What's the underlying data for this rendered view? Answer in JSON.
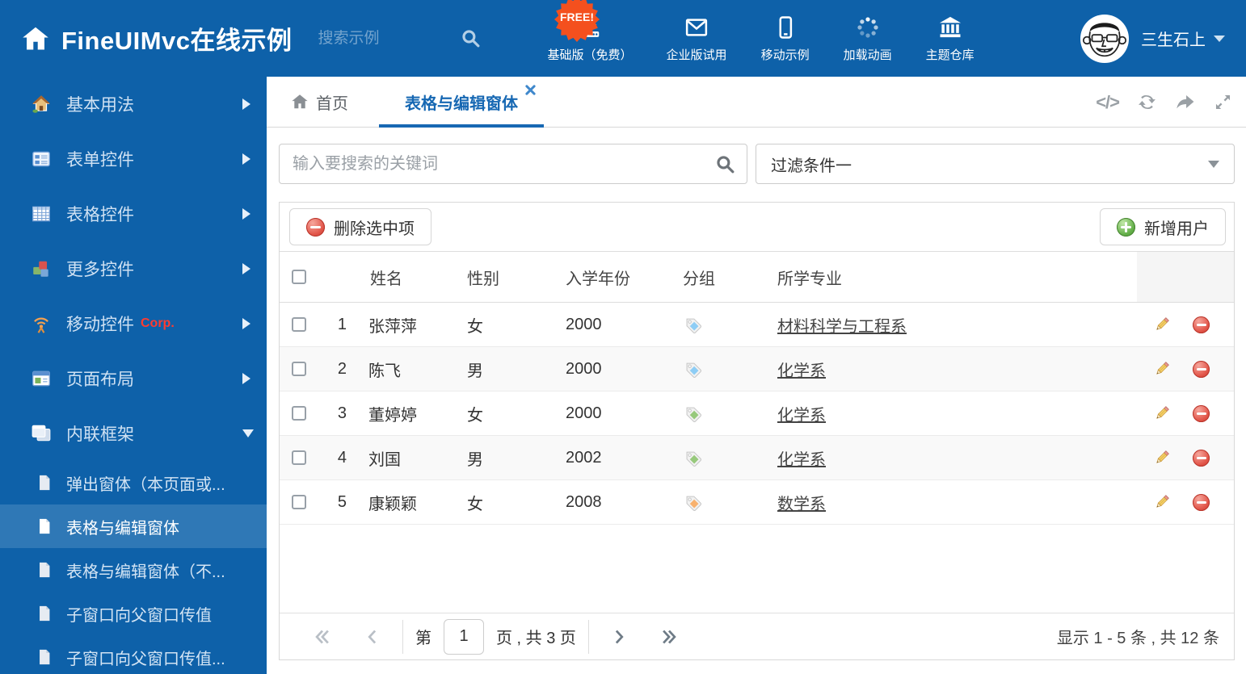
{
  "header": {
    "logo_text": "FineUIMvc在线示例",
    "search_placeholder": "搜索示例",
    "free_badge": "FREE!",
    "free_badge_color": "#f4501e",
    "nav_items": [
      {
        "label": "基础版（免费）",
        "icon": "download-icon"
      },
      {
        "label": "企业版试用",
        "icon": "envelope-icon"
      },
      {
        "label": "移动示例",
        "icon": "mobile-icon"
      },
      {
        "label": "加载动画",
        "icon": "spinner-icon"
      },
      {
        "label": "主题仓库",
        "icon": "bank-icon"
      }
    ],
    "user": {
      "name": "三生石上"
    }
  },
  "sidebar": {
    "items": [
      {
        "label": "基本用法",
        "icon": "house-icon"
      },
      {
        "label": "表单控件",
        "icon": "form-icon"
      },
      {
        "label": "表格控件",
        "icon": "grid-icon"
      },
      {
        "label": "更多控件",
        "icon": "cubes-icon"
      },
      {
        "label": "移动控件",
        "badge": "Corp.",
        "icon": "antenna-icon"
      },
      {
        "label": "页面布局",
        "icon": "layout-icon"
      },
      {
        "label": "内联框架",
        "icon": "frames-icon",
        "expanded": true
      }
    ],
    "subitems": [
      {
        "label": "弹出窗体（本页面或..."
      },
      {
        "label": "表格与编辑窗体",
        "active": true
      },
      {
        "label": "表格与编辑窗体（不..."
      },
      {
        "label": "子窗口向父窗口传值"
      },
      {
        "label": "子窗口向父窗口传值..."
      }
    ]
  },
  "tabs": {
    "home": {
      "label": "首页",
      "icon": "home-icon"
    },
    "active": {
      "label": "表格与编辑窗体",
      "closable": true
    }
  },
  "tab_tools": [
    "code-icon",
    "refresh-icon",
    "share-icon",
    "expand-icon"
  ],
  "filters": {
    "search_placeholder": "输入要搜索的关键词",
    "filter_value": "过滤条件一"
  },
  "toolbar": {
    "delete_label": "删除选中项",
    "add_label": "新增用户"
  },
  "table": {
    "columns": {
      "name": "姓名",
      "gender": "性别",
      "year": "入学年份",
      "group": "分组",
      "major": "所学专业"
    },
    "rows": [
      {
        "index": "1",
        "name": "张萍萍",
        "gender": "女",
        "year": "2000",
        "tag_color": "#8ecdf5",
        "major": "材料科学与工程系"
      },
      {
        "index": "2",
        "name": "陈飞",
        "gender": "男",
        "year": "2000",
        "tag_color": "#8ecdf5",
        "major": "化学系"
      },
      {
        "index": "3",
        "name": "董婷婷",
        "gender": "女",
        "year": "2000",
        "tag_color": "#97c97c",
        "major": "化学系"
      },
      {
        "index": "4",
        "name": "刘国",
        "gender": "男",
        "year": "2002",
        "tag_color": "#97c97c",
        "major": "化学系"
      },
      {
        "index": "5",
        "name": "康颖颖",
        "gender": "女",
        "year": "2008",
        "tag_color": "#f8b26f",
        "major": "数学系"
      }
    ]
  },
  "pagination": {
    "page_prefix": "第",
    "current_page": "1",
    "page_suffix": "页 , 共 3 页",
    "summary": "显示 1 - 5 条 , 共 12 条"
  },
  "colors": {
    "accent_blue": "#0e61a9",
    "active_tab_blue": "#1768b3",
    "selected_item_blue": "#2f78b6",
    "delete_red": "#e2564a",
    "add_green": "#65b04a"
  }
}
